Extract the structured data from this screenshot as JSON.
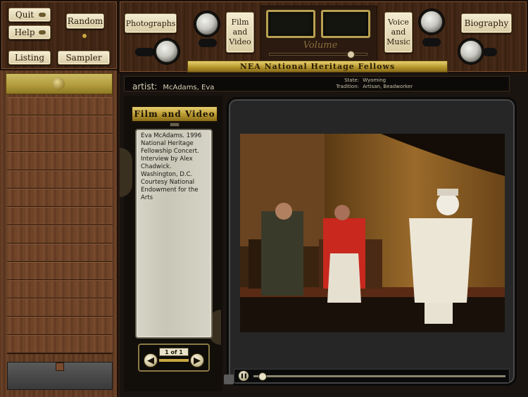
{
  "app": {
    "quit_label": "Quit",
    "help_label": "Help",
    "random_label": "Random",
    "listing_label": "Listing",
    "sampler_label": "Sampler"
  },
  "media_tabs": {
    "photographs_label": "Photographs",
    "film_line1": "Film",
    "film_line2": "and",
    "film_line3": "Video",
    "voice_line1": "Voice",
    "voice_line2": "and",
    "voice_line3": "Music",
    "biography_label": "Biography",
    "volume_label": "Volume",
    "volume_level": 0.85
  },
  "banner": {
    "title": "NEA National Heritage Fellows"
  },
  "artist_bar": {
    "artist_prefix": "artist:",
    "artist_name": "McAdams, Eva",
    "state_label": "State:",
    "state_value": "Wyoming",
    "tradition_label": "Tradition:",
    "tradition_value": "Artisan, Beadworker"
  },
  "film_panel": {
    "heading": "Film and Video",
    "caption": "Eva McAdams. 1996 National Heritage Fellowship Concert. Interview by Alex Chadwick. Washington, D.C. Courtesy National Endowment for the Arts",
    "pager_text": "1 of 1"
  },
  "player": {
    "progress": 0.02,
    "pause_symbol": "❚❚"
  },
  "colors": {
    "gold_banner": "#c9b458",
    "wood": "#6b4228",
    "screen_bg": "#2b2b2b"
  }
}
